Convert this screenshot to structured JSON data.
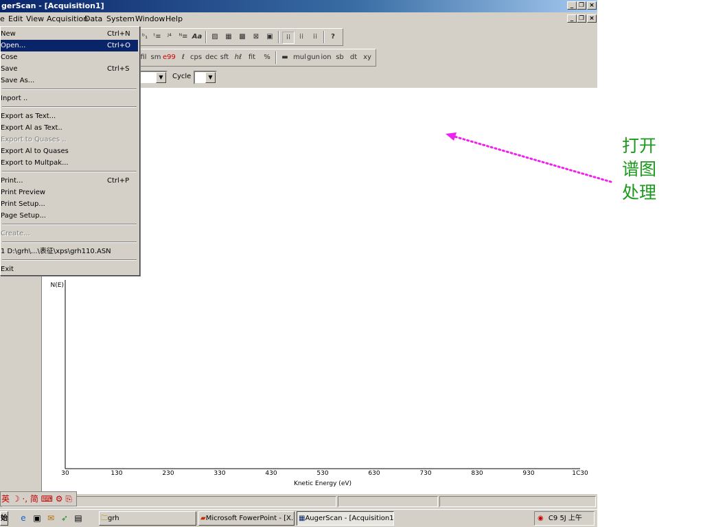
{
  "window": {
    "title": "gerScan - [Acquisition1]",
    "caption_buttons": [
      "_",
      "❐",
      "×"
    ]
  },
  "menubar": [
    {
      "label": "e"
    },
    {
      "label": "Edit"
    },
    {
      "label": "View"
    },
    {
      "label": "Acquisition"
    },
    {
      "label": "Data"
    },
    {
      "label": "System"
    },
    {
      "label": "Window"
    },
    {
      "label": "Help"
    }
  ],
  "toolbar": {
    "row1_icons": [
      "sort-icon",
      "sort-desc-icon",
      "align-right-icon",
      "align-left-icon",
      "font-aa-icon",
      "chart-icon",
      "window-icon",
      "image-icon",
      "crop-icon",
      "doc-icon",
      "grid-select-icon",
      "grid2-icon",
      "grid3-icon",
      "help-icon"
    ],
    "row1_labels": [
      "ᵇ₁",
      "ᵗ≡",
      "ᴶ⁴",
      "ᴺ≡",
      "Aa",
      "▨",
      "▦",
      "▩",
      "⊠",
      "▣",
      "⁞⁞",
      "⁞⁞",
      "⁞⁞",
      "?"
    ],
    "row2_labels": [
      "fil",
      "sm",
      "e99",
      "ℓ",
      "cps",
      "dec",
      "sft",
      "ℎℓ",
      "fit",
      "%",
      "▬",
      "mul",
      "gun",
      "ion",
      "sb",
      "dt",
      "xy"
    ],
    "cycle_label": "Cycle"
  },
  "file_menu": {
    "items": [
      {
        "label": "New",
        "shortcut": "Ctrl+N"
      },
      {
        "label": "Open...",
        "shortcut": "Ctrl+O",
        "selected": true
      },
      {
        "label": "Cose",
        "shortcut": ""
      },
      {
        "label": "Save",
        "shortcut": "Ctrl+S"
      },
      {
        "label": "Save As...",
        "shortcut": ""
      },
      {
        "label": "Inport ..",
        "shortcut": ""
      },
      {
        "label": "Export as Text...",
        "shortcut": ""
      },
      {
        "label": "Export Al as Text..",
        "shortcut": ""
      },
      {
        "label": "Export to Quases ..",
        "shortcut": "",
        "disabled": true
      },
      {
        "label": "Export Al to Quases",
        "shortcut": ""
      },
      {
        "label": "Export to Multpak...",
        "shortcut": ""
      },
      {
        "label": "Print...",
        "shortcut": "Ctrl+P"
      },
      {
        "label": "Print Preview",
        "shortcut": ""
      },
      {
        "label": "Print Setup...",
        "shortcut": ""
      },
      {
        "label": "Page Setup...",
        "shortcut": ""
      },
      {
        "label": "Create...",
        "shortcut": "",
        "disabled": true
      },
      {
        "label": "1 D:\\grh\\...\\表征\\xps\\grh110.ASN",
        "shortcut": ""
      },
      {
        "label": "Exit",
        "shortcut": ""
      }
    ]
  },
  "chart_data": {
    "type": "line",
    "title": "",
    "xlabel": "Knetic Energy (eV)",
    "ylabel": "N(E)",
    "x_ticks": [
      "30",
      "130",
      "230",
      "330",
      "430",
      "530",
      "630",
      "730",
      "830",
      "930",
      "1C30"
    ],
    "xlim": [
      30,
      1030
    ],
    "series": [],
    "grid": false
  },
  "ime_bar": {
    "text": "英 ☽ ·, 简 ⌨ ⚙ ⎘"
  },
  "taskbar": {
    "start_text": "始",
    "quick_icons": [
      "ie-icon",
      "desktop-icon",
      "outlook-icon",
      "arrow-icon",
      "app-icon"
    ],
    "buttons": [
      {
        "label": "grh",
        "icon": "folder-icon"
      },
      {
        "label": "Microsoft FowerPoint - [X...",
        "icon": "powerpoint-icon"
      },
      {
        "label": "AugerScan - [Acquisition1]",
        "icon": "augerscan-icon",
        "active": true
      }
    ],
    "clock": "C9 5J 上午"
  },
  "annotation": {
    "lines": [
      "打开",
      "谱图",
      "处理"
    ],
    "color": "#1a9a1a",
    "arrow_color": "#ee22ee"
  }
}
